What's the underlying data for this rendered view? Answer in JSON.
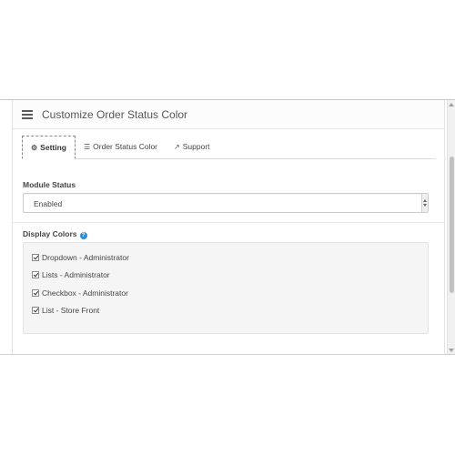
{
  "panel": {
    "title": "Customize Order Status Color",
    "title_icon": "list-icon"
  },
  "tabs": [
    {
      "label": "Setting",
      "icon": "cogs-icon",
      "active": true
    },
    {
      "label": "Order Status Color",
      "icon": "list-icon",
      "active": false
    },
    {
      "label": "Support",
      "icon": "external-link-icon",
      "active": false
    }
  ],
  "module_status": {
    "label": "Module Status",
    "value": "Enabled"
  },
  "display_colors": {
    "label": "Display Colors",
    "help_icon": "question-circle-icon",
    "options": [
      {
        "label": "Dropdown - Administrator",
        "checked": true
      },
      {
        "label": "Lists - Administrator",
        "checked": true
      },
      {
        "label": "Checkbox - Administrator",
        "checked": true
      },
      {
        "label": "List - Store Front",
        "checked": true
      }
    ]
  },
  "colors": {
    "help_badge": "#2e8fd6",
    "well_bg": "#f5f5f5"
  }
}
